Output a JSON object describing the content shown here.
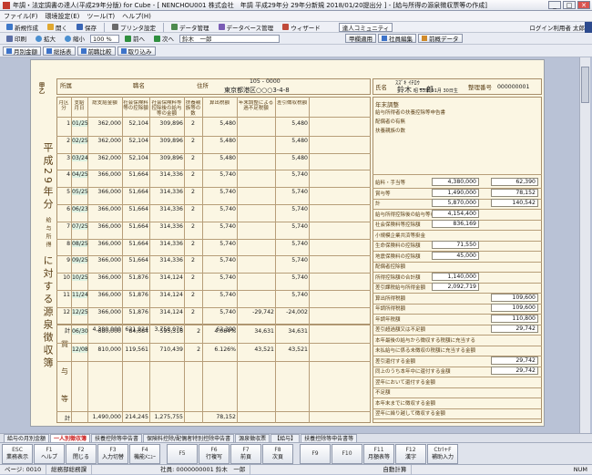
{
  "window": {
    "title": "年調・法定調書の達人(平成29年分版) for Cube - [ NENCHOU001 株式会社　年調 平成29年分 29年分新規 2018/01/20提出分 ] - [給与所得の源泉徴収票等の作成]"
  },
  "menu": [
    "ファイル(F)",
    "環境設定(E)",
    "ツール(T)",
    "ヘルプ(H)"
  ],
  "toolbar1": {
    "items": [
      "新規作成",
      "開く",
      "保存",
      "プリンタ設定",
      "データ管理",
      "データベース管理",
      "ウィザード"
    ],
    "community": "達人コミュニティ",
    "login": "ログイン利用者 太郎"
  },
  "toolbar2": {
    "print": "印刷",
    "zoom_in": "拡大",
    "zoom_out": "縮小",
    "zoom": "100 %",
    "prev": "前へ",
    "next": "次へ",
    "employee": "鈴木　一郎",
    "kouotsu": "甲欄適用",
    "jp_btn": "社員編集",
    "prev_data": "前概データ"
  },
  "toolbar3": {
    "b1": "月別金額",
    "b2": "総括表",
    "b3": "前職比較",
    "b4": "取り込み"
  },
  "doc": {
    "title": [
      "平成29年分",
      "給与所得",
      "に対する源泉徴収簿"
    ],
    "kou_otsu": "甲乙",
    "shozoku": "所属",
    "shokumei": "職名",
    "address": "住所",
    "address_val": "東京都港区○○○3-4-8",
    "zip": "105 - 0000",
    "name_label": "氏名",
    "name_kana": "ｽｽﾞｷ ｲﾁﾛｳ",
    "name": "鈴木　一郎",
    "seiri": "整理番号",
    "seiri_no": "000000001",
    "birth": "昭 53年 01月 30日生",
    "headers": [
      "月区分",
      "支給月日",
      "総支給金額",
      "社会保険料等の控除額",
      "社会保険料等控除後の給与等の金額",
      "扶養親族等の数",
      "算出税額",
      "年末調整による過不足税額",
      "差引徴収税額"
    ],
    "salary_rows": [
      [
        "1",
        "01/25",
        "362,000",
        "52,104",
        "309,896",
        "2",
        "5,480",
        "",
        "5,480"
      ],
      [
        "2",
        "02/25",
        "362,000",
        "52,104",
        "309,896",
        "2",
        "5,480",
        "",
        "5,480"
      ],
      [
        "3",
        "03/24",
        "362,000",
        "52,104",
        "309,896",
        "2",
        "5,480",
        "",
        "5,480"
      ],
      [
        "4",
        "04/25",
        "366,000",
        "51,664",
        "314,336",
        "2",
        "5,740",
        "",
        "5,740"
      ],
      [
        "5",
        "05/25",
        "366,000",
        "51,664",
        "314,336",
        "2",
        "5,740",
        "",
        "5,740"
      ],
      [
        "6",
        "06/23",
        "366,000",
        "51,664",
        "314,336",
        "2",
        "5,740",
        "",
        "5,740"
      ],
      [
        "7",
        "07/25",
        "366,000",
        "51,664",
        "314,336",
        "2",
        "5,740",
        "",
        "5,740"
      ],
      [
        "8",
        "08/25",
        "366,000",
        "51,664",
        "314,336",
        "2",
        "5,740",
        "",
        "5,740"
      ],
      [
        "9",
        "09/25",
        "366,000",
        "51,664",
        "314,336",
        "2",
        "5,740",
        "",
        "5,740"
      ],
      [
        "10",
        "10/25",
        "366,000",
        "51,876",
        "314,124",
        "2",
        "5,740",
        "",
        "5,740"
      ],
      [
        "11",
        "11/24",
        "366,000",
        "51,876",
        "314,124",
        "2",
        "5,740",
        "",
        "5,740"
      ],
      [
        "12",
        "12/25",
        "366,000",
        "51,876",
        "314,124",
        "2",
        "5,740",
        "-29,742",
        "-24,002"
      ]
    ],
    "salary_total": [
      "計",
      "4,380,000",
      "621,924",
      "3,758,076",
      "",
      "62,390"
    ],
    "bonus_rows": [
      [
        "06/30",
        "680,000",
        "84,684",
        "595,316",
        "2",
        "4.084%",
        "34,631",
        "34,631"
      ],
      [
        "12/08",
        "810,000",
        "119,561",
        "710,439",
        "2",
        "6.126%",
        "43,521",
        "43,521"
      ]
    ],
    "bonus_total": [
      "計",
      "1,490,000",
      "214,245",
      "1,275,755",
      "",
      "78,152"
    ],
    "bonus_labels": [
      "賞",
      "与",
      "等"
    ],
    "right_items": [
      {
        "label": "給料・手当等",
        "amount": "4,380,000",
        "tax": "62,390"
      },
      {
        "label": "賞与等",
        "amount": "1,490,000",
        "tax": "78,152"
      },
      {
        "label": "計",
        "amount": "5,870,000",
        "tax": "140,542"
      },
      {
        "label": "給与所得控除後の給与等の金額",
        "amount": "4,154,400"
      },
      {
        "label": "社会保険料等控除額",
        "amount": "836,169"
      },
      {
        "label": "小規模企業共済等掛金",
        "amount": ""
      },
      {
        "label": "生命保険料の控除額",
        "amount": "71,550"
      },
      {
        "label": "地震保険料の控除額",
        "amount": "45,000"
      },
      {
        "label": "配偶者控除額",
        "amount": ""
      },
      {
        "label": "所得控除額の合計額",
        "amount": "1,140,000"
      },
      {
        "label": "差引課税給与所得金額",
        "amount": "2,092,719"
      },
      {
        "label": "算出所得税額",
        "amount": "",
        "tax": "109,600"
      },
      {
        "label": "年調所得税額",
        "amount": "",
        "tax": "109,600"
      },
      {
        "label": "年調年税額",
        "amount": "",
        "tax": "110,800"
      },
      {
        "label": "差引超過額又は不足額",
        "amount": "",
        "tax": "29,742"
      },
      {
        "label": "本年最後の給与から徴収する税額に充当する金額",
        "amount": ""
      },
      {
        "label": "未払給与に係る未徴収の税額に充当する金額",
        "amount": ""
      },
      {
        "label": "差引還付する金額",
        "amount": "",
        "tax": "29,742"
      },
      {
        "label": "同上のうち本年中に還付する金額",
        "amount": "",
        "tax": "29,742"
      },
      {
        "label": "翌年において還付する金額",
        "amount": ""
      },
      {
        "label": "不足額",
        "amount": ""
      },
      {
        "label": "本年末までに徴収する金額",
        "amount": ""
      },
      {
        "label": "翌年に繰り越して徴収する金額",
        "amount": ""
      }
    ],
    "right_top_labels": [
      "年末調整",
      "給与所得者の扶養控除等申告書",
      "配偶者の有無",
      "扶養親族の数"
    ]
  },
  "sheet_tabs": [
    "給与の月別金額",
    "一人別徴収簿",
    "扶養控除等申告書",
    "保険料控除/配偶者特別控除申告書",
    "源泉徴収票",
    "【給与】",
    "扶養控除等申告書等"
  ],
  "fkeys": [
    {
      "n": "ESC",
      "l": "業務表示"
    },
    {
      "n": "F1",
      "l": "ヘルプ"
    },
    {
      "n": "F2",
      "l": "閉じる"
    },
    {
      "n": "F3",
      "l": "入力切替"
    },
    {
      "n": "F4",
      "l": "機能ﾒﾆｭｰ"
    },
    {
      "n": "F5",
      "l": ""
    },
    {
      "n": "F6",
      "l": "行複写"
    },
    {
      "n": "F7",
      "l": "前頁"
    },
    {
      "n": "F8",
      "l": "次頁"
    },
    {
      "n": "F9",
      "l": ""
    },
    {
      "n": "F10",
      "l": ""
    },
    {
      "n": "F11",
      "l": "月額表等"
    },
    {
      "n": "F12",
      "l": "漢字"
    },
    {
      "n": "Ctrl+F",
      "l": "補助入力"
    }
  ],
  "status": {
    "page": "ページ: 0010",
    "dept": "総務部総務課",
    "employee": "社員: 0000000001 鈴木　一郎",
    "calc": "自動計算",
    "num": "NUM"
  }
}
